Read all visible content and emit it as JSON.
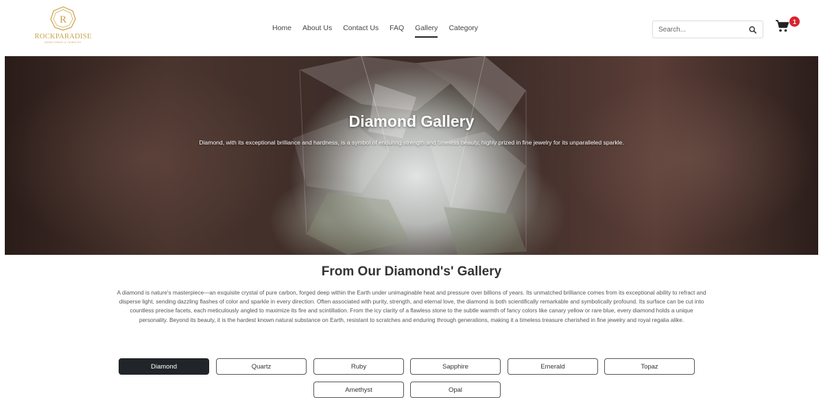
{
  "brand": {
    "name": "ROCKPARADISE",
    "tagline": "GEMSTONES & JEWELRY",
    "color": "#c9a24b"
  },
  "nav": {
    "items": [
      {
        "label": "Home",
        "active": false
      },
      {
        "label": "About Us",
        "active": false
      },
      {
        "label": "Contact Us",
        "active": false
      },
      {
        "label": "FAQ",
        "active": false
      },
      {
        "label": "Gallery",
        "active": true
      },
      {
        "label": "Category",
        "active": false
      }
    ]
  },
  "search": {
    "placeholder": "Search...",
    "icon": "search-icon"
  },
  "cart": {
    "icon": "cart-icon",
    "count": "1",
    "badge_color": "#d9232e"
  },
  "hero": {
    "title": "Diamond Gallery",
    "subtitle": "Diamond, with its exceptional brilliance and hardness, is a symbol of enduring strength and timeless beauty, highly prized in fine jewelry for its unparalleled sparkle."
  },
  "gallery": {
    "title": "From Our Diamond's' Gallery",
    "description": "A diamond is nature's masterpiece—an exquisite crystal of pure carbon, forged deep within the Earth under unimaginable heat and pressure over billions of years. Its unmatched brilliance comes from its exceptional ability to refract and disperse light, sending dazzling flashes of color and sparkle in every direction. Often associated with purity, strength, and eternal love, the diamond is both scientifically remarkable and symbolically profound. Its surface can be cut into countless precise facets, each meticulously angled to maximize its fire and scintillation. From the icy clarity of a flawless stone to the subtle warmth of fancy colors like canary yellow or rare blue, every diamond holds a unique personality. Beyond its beauty, it is the hardest known natural substance on Earth, resistant to scratches and enduring through generations, making it a timeless treasure cherished in fine jewelry and royal regalia alike."
  },
  "categories": [
    {
      "label": "Diamond",
      "active": true
    },
    {
      "label": "Quartz",
      "active": false
    },
    {
      "label": "Ruby",
      "active": false
    },
    {
      "label": "Sapphire",
      "active": false
    },
    {
      "label": "Emerald",
      "active": false
    },
    {
      "label": "Topaz",
      "active": false
    },
    {
      "label": "Amethyst",
      "active": false
    },
    {
      "label": "Opal",
      "active": false
    }
  ],
  "colors": {
    "active_button": "#212529"
  }
}
